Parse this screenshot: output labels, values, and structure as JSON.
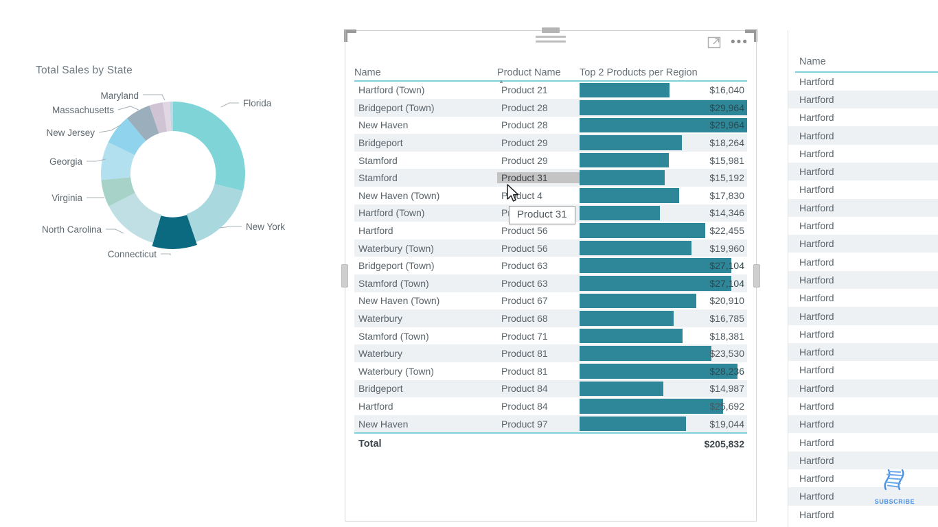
{
  "donut": {
    "title": "Total Sales by State",
    "chart_type": "donut",
    "labels": [
      "Florida",
      "New York",
      "Connecticut",
      "North Carolina",
      "Virginia",
      "Georgia",
      "New Jersey",
      "Massachusetts",
      "Maryland"
    ]
  },
  "table_visual": {
    "icons": {
      "focus": "focus-mode-icon",
      "more": "•••",
      "drag": "drag-handle-icon"
    },
    "columns": [
      "Name",
      "Product Name",
      "Top 2 Products per Region"
    ],
    "sort_column": "Product Name",
    "sort_direction": "ascending",
    "bar_color": "#2e8798",
    "header_rule_color": "#7fd0d8",
    "max_value": 29964,
    "rows": [
      {
        "name": "Hartford (Town)",
        "product": "Product 21",
        "value": 16040,
        "value_label": "$16,040"
      },
      {
        "name": "Bridgeport (Town)",
        "product": "Product 28",
        "value": 29964,
        "value_label": "$29,964"
      },
      {
        "name": "New Haven",
        "product": "Product 28",
        "value": 29964,
        "value_label": "$29,964"
      },
      {
        "name": "Bridgeport",
        "product": "Product 29",
        "value": 18264,
        "value_label": "$18,264"
      },
      {
        "name": "Stamford",
        "product": "Product 29",
        "value": 15981,
        "value_label": "$15,981"
      },
      {
        "name": "Stamford",
        "product": "Product 31",
        "value": 15192,
        "value_label": "$15,192"
      },
      {
        "name": "New Haven (Town)",
        "product": "Product 4",
        "value": 17830,
        "value_label": "$17,830"
      },
      {
        "name": "Hartford (Town)",
        "product": "Product 51",
        "value": 14346,
        "value_label": "$14,346"
      },
      {
        "name": "Hartford",
        "product": "Product 56",
        "value": 22455,
        "value_label": "$22,455"
      },
      {
        "name": "Waterbury (Town)",
        "product": "Product 56",
        "value": 19960,
        "value_label": "$19,960"
      },
      {
        "name": "Bridgeport (Town)",
        "product": "Product 63",
        "value": 27104,
        "value_label": "$27,104"
      },
      {
        "name": "Stamford (Town)",
        "product": "Product 63",
        "value": 27104,
        "value_label": "$27,104"
      },
      {
        "name": "New Haven (Town)",
        "product": "Product 67",
        "value": 20910,
        "value_label": "$20,910"
      },
      {
        "name": "Waterbury",
        "product": "Product 68",
        "value": 16785,
        "value_label": "$16,785"
      },
      {
        "name": "Stamford (Town)",
        "product": "Product 71",
        "value": 18381,
        "value_label": "$18,381"
      },
      {
        "name": "Waterbury",
        "product": "Product 81",
        "value": 23530,
        "value_label": "$23,530"
      },
      {
        "name": "Waterbury (Town)",
        "product": "Product 81",
        "value": 28236,
        "value_label": "$28,236"
      },
      {
        "name": "Bridgeport",
        "product": "Product 84",
        "value": 14987,
        "value_label": "$14,987"
      },
      {
        "name": "Hartford",
        "product": "Product 84",
        "value": 25692,
        "value_label": "$25,692"
      },
      {
        "name": "New Haven",
        "product": "Product 97",
        "value": 19044,
        "value_label": "$19,044"
      }
    ],
    "total_label": "Total",
    "total_value": "$205,832",
    "tooltip": "Product 31",
    "hovered_cell": "Product 31"
  },
  "right_table": {
    "header": "Name",
    "rows": [
      "Hartford",
      "Hartford",
      "Hartford",
      "Hartford",
      "Hartford",
      "Hartford",
      "Hartford",
      "Hartford",
      "Hartford",
      "Hartford",
      "Hartford",
      "Hartford",
      "Hartford",
      "Hartford",
      "Hartford",
      "Hartford",
      "Hartford",
      "Hartford",
      "Hartford",
      "Hartford",
      "Hartford",
      "Hartford",
      "Hartford",
      "Hartford",
      "Hartford"
    ]
  },
  "subscribe": {
    "label": "SUBSCRIBE",
    "color": "#4a90e2"
  },
  "chart_data": {
    "type": "pie",
    "title": "Total Sales by State",
    "categories": [
      "Florida",
      "New York",
      "Connecticut",
      "North Carolina",
      "Virginia",
      "Georgia",
      "New Jersey",
      "Massachusetts",
      "Maryland"
    ],
    "values": [
      26.5,
      20.0,
      9.5,
      9.0,
      7.5,
      8.5,
      7.0,
      7.0,
      5.0
    ],
    "colors": [
      "#7fd4d8",
      "#a9d8de",
      "#9fd1d9",
      "#0b6a7f",
      "#bfdfe5",
      "#b3e0ef",
      "#8fd3ec",
      "#82c6e0",
      "#9aaebb"
    ],
    "legend": "labels-outside-with-leader-lines",
    "grid": false,
    "xlabel": "",
    "ylabel": ""
  }
}
